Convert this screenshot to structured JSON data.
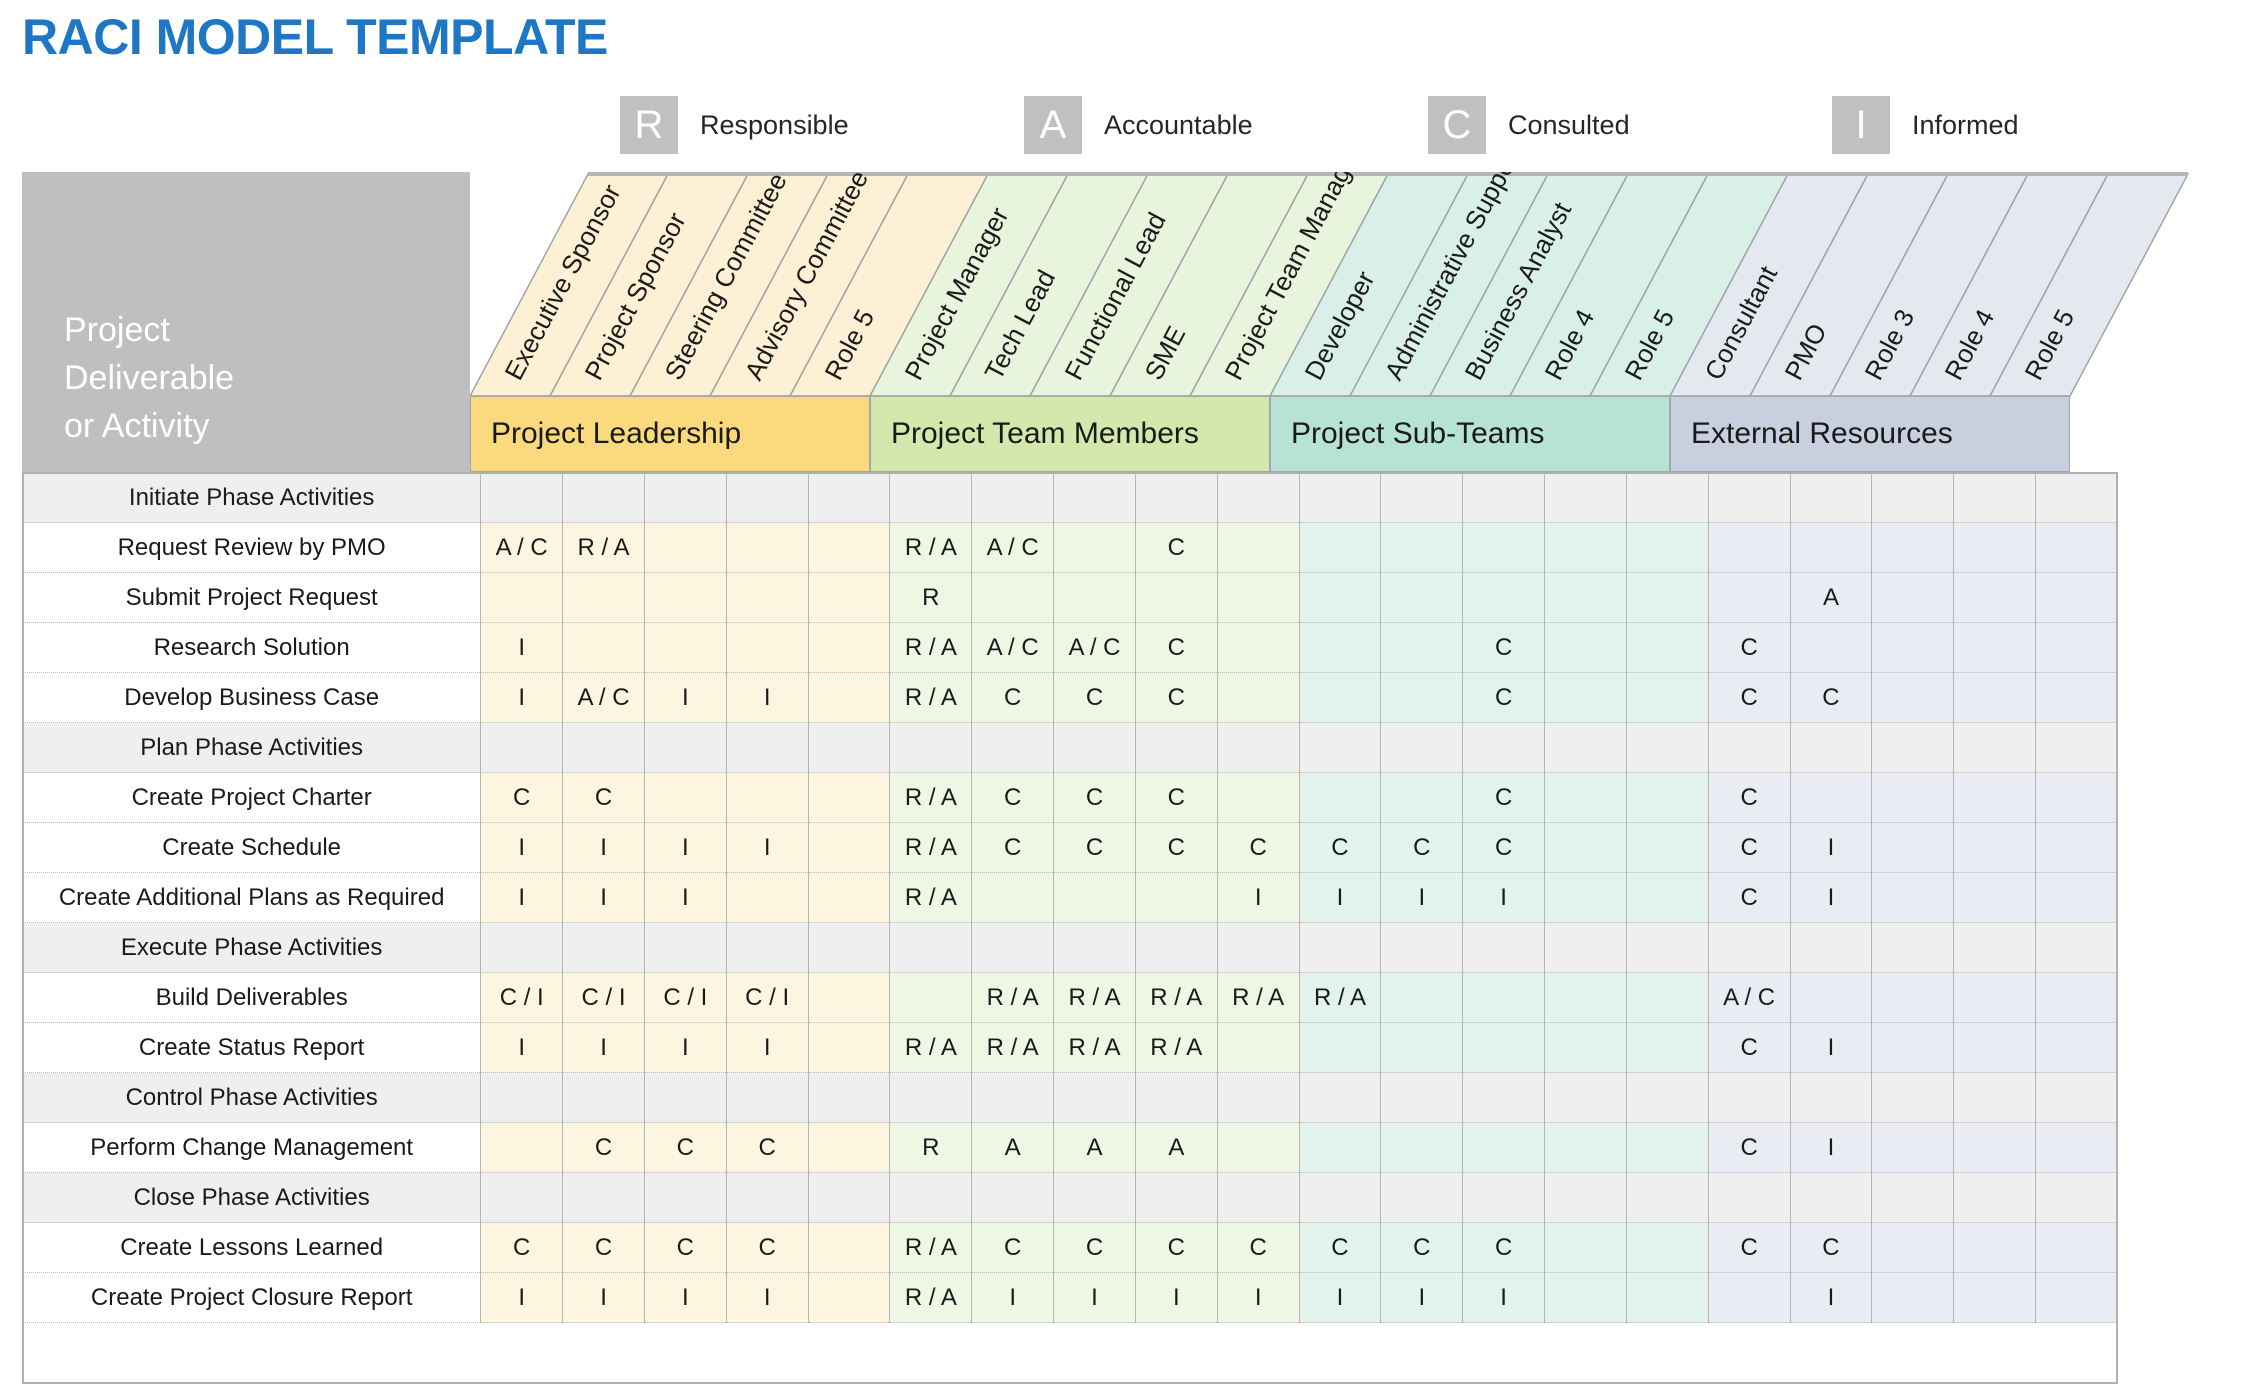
{
  "title": "RACI MODEL TEMPLATE",
  "legend": [
    {
      "letter": "R",
      "label": "Responsible"
    },
    {
      "letter": "A",
      "label": "Accountable"
    },
    {
      "letter": "C",
      "label": "Consulted"
    },
    {
      "letter": "I",
      "label": "Informed"
    }
  ],
  "corner_label": "Project\nDeliverable\nor Activity",
  "groups": [
    {
      "name": "Project Leadership",
      "color": "#fbd97d",
      "column_fill": "#fdf0d4",
      "span": 5
    },
    {
      "name": "Project Team Members",
      "color": "#d3e8ad",
      "column_fill": "#e9f4dc",
      "span": 5
    },
    {
      "name": "Project Sub-Teams",
      "color": "#b6e3d4",
      "column_fill": "#d9f0e8",
      "span": 5
    },
    {
      "name": "External Resources",
      "color": "#c8cfdf",
      "column_fill": "#e4e8ef",
      "span": 5
    }
  ],
  "columns": [
    {
      "label": "Executive Sponsor",
      "group": 0
    },
    {
      "label": "Project Sponsor",
      "group": 0
    },
    {
      "label": "Steering Committee",
      "group": 0
    },
    {
      "label": "Advisory Committee",
      "group": 0
    },
    {
      "label": "Role 5",
      "group": 0
    },
    {
      "label": "Project Manager",
      "group": 1
    },
    {
      "label": "Tech Lead",
      "group": 1
    },
    {
      "label": "Functional Lead",
      "group": 1
    },
    {
      "label": "SME",
      "group": 1
    },
    {
      "label": "Project Team Manager",
      "group": 1
    },
    {
      "label": "Developer",
      "group": 2
    },
    {
      "label": "Administrative Support",
      "group": 2
    },
    {
      "label": "Business Analyst",
      "group": 2
    },
    {
      "label": "Role 4",
      "group": 2
    },
    {
      "label": "Role 5",
      "group": 2
    },
    {
      "label": "Consultant",
      "group": 3
    },
    {
      "label": "PMO",
      "group": 3
    },
    {
      "label": "Role 3",
      "group": 3
    },
    {
      "label": "Role 4",
      "group": 3
    },
    {
      "label": "Role 5",
      "group": 3
    }
  ],
  "rows": [
    {
      "type": "phase",
      "label": "Initiate Phase Activities",
      "cells": [
        "",
        "",
        "",
        "",
        "",
        "",
        "",
        "",
        "",
        "",
        "",
        "",
        "",
        "",
        "",
        "",
        "",
        "",
        "",
        ""
      ]
    },
    {
      "type": "activity",
      "label": "Request Review by PMO",
      "cells": [
        "A / C",
        "R / A",
        "",
        "",
        "",
        "R / A",
        "A / C",
        "",
        "C",
        "",
        "",
        "",
        "",
        "",
        "",
        "",
        "",
        "",
        "",
        ""
      ]
    },
    {
      "type": "activity",
      "label": "Submit Project Request",
      "cells": [
        "",
        "",
        "",
        "",
        "",
        "R",
        "",
        "",
        "",
        "",
        "",
        "",
        "",
        "",
        "",
        "",
        "A",
        "",
        "",
        ""
      ]
    },
    {
      "type": "activity",
      "label": "Research Solution",
      "cells": [
        "I",
        "",
        "",
        "",
        "",
        "R / A",
        "A / C",
        "A / C",
        "C",
        "",
        "",
        "",
        "C",
        "",
        "",
        "C",
        "",
        "",
        "",
        ""
      ]
    },
    {
      "type": "activity",
      "label": "Develop Business Case",
      "cells": [
        "I",
        "A / C",
        "I",
        "I",
        "",
        "R / A",
        "C",
        "C",
        "C",
        "",
        "",
        "",
        "C",
        "",
        "",
        "C",
        "C",
        "",
        "",
        ""
      ]
    },
    {
      "type": "phase",
      "label": "Plan Phase Activities",
      "cells": [
        "",
        "",
        "",
        "",
        "",
        "",
        "",
        "",
        "",
        "",
        "",
        "",
        "",
        "",
        "",
        "",
        "",
        "",
        "",
        ""
      ]
    },
    {
      "type": "activity",
      "label": "Create Project Charter",
      "cells": [
        "C",
        "C",
        "",
        "",
        "",
        "R / A",
        "C",
        "C",
        "C",
        "",
        "",
        "",
        "C",
        "",
        "",
        "C",
        "",
        "",
        "",
        ""
      ]
    },
    {
      "type": "activity",
      "label": "Create Schedule",
      "cells": [
        "I",
        "I",
        "I",
        "I",
        "",
        "R / A",
        "C",
        "C",
        "C",
        "C",
        "C",
        "C",
        "C",
        "",
        "",
        "C",
        "I",
        "",
        "",
        ""
      ]
    },
    {
      "type": "activity",
      "label": "Create Additional Plans as Required",
      "cells": [
        "I",
        "I",
        "I",
        "",
        "",
        "R / A",
        "",
        "",
        "",
        "I",
        "I",
        "I",
        "I",
        "",
        "",
        "C",
        "I",
        "",
        "",
        ""
      ]
    },
    {
      "type": "phase",
      "label": "Execute Phase Activities",
      "cells": [
        "",
        "",
        "",
        "",
        "",
        "",
        "",
        "",
        "",
        "",
        "",
        "",
        "",
        "",
        "",
        "",
        "",
        "",
        "",
        ""
      ]
    },
    {
      "type": "activity",
      "label": "Build Deliverables",
      "cells": [
        "C / I",
        "C / I",
        "C / I",
        "C / I",
        "",
        "",
        "R / A",
        "R / A",
        "R / A",
        "R / A",
        "R / A",
        "",
        "",
        "",
        "",
        "A / C",
        "",
        "",
        "",
        ""
      ]
    },
    {
      "type": "activity",
      "label": "Create Status Report",
      "cells": [
        "I",
        "I",
        "I",
        "I",
        "",
        "R / A",
        "R / A",
        "R / A",
        "R / A",
        "",
        "",
        "",
        "",
        "",
        "",
        "C",
        "I",
        "",
        "",
        ""
      ]
    },
    {
      "type": "phase",
      "label": "Control Phase Activities",
      "cells": [
        "",
        "",
        "",
        "",
        "",
        "",
        "",
        "",
        "",
        "",
        "",
        "",
        "",
        "",
        "",
        "",
        "",
        "",
        "",
        ""
      ]
    },
    {
      "type": "activity",
      "label": "Perform Change Management",
      "cells": [
        "",
        "C",
        "C",
        "C",
        "",
        "R",
        "A",
        "A",
        "A",
        "",
        "",
        "",
        "",
        "",
        "",
        "C",
        "I",
        "",
        "",
        ""
      ]
    },
    {
      "type": "phase",
      "label": "Close Phase Activities",
      "cells": [
        "",
        "",
        "",
        "",
        "",
        "",
        "",
        "",
        "",
        "",
        "",
        "",
        "",
        "",
        "",
        "",
        "",
        "",
        "",
        ""
      ]
    },
    {
      "type": "activity",
      "label": "Create Lessons Learned",
      "cells": [
        "C",
        "C",
        "C",
        "C",
        "",
        "R / A",
        "C",
        "C",
        "C",
        "C",
        "C",
        "C",
        "C",
        "",
        "",
        "C",
        "C",
        "",
        "",
        ""
      ]
    },
    {
      "type": "activity",
      "label": "Create Project Closure Report",
      "cells": [
        "I",
        "I",
        "I",
        "I",
        "",
        "R / A",
        "I",
        "I",
        "I",
        "I",
        "I",
        "I",
        "I",
        "",
        "",
        "",
        "I",
        "",
        "",
        ""
      ]
    }
  ]
}
